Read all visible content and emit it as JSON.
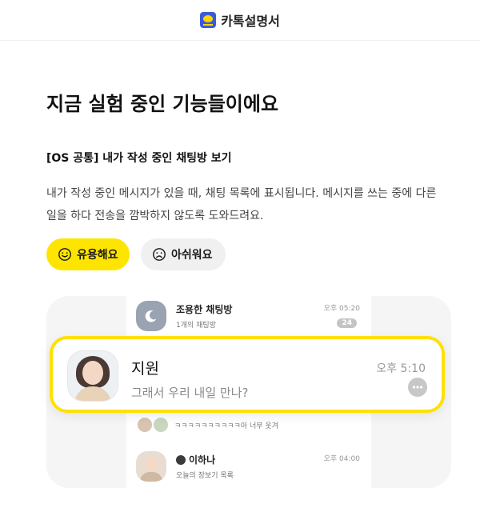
{
  "header": {
    "logo_text": "카톡설명서"
  },
  "page": {
    "title": "지금 실험 중인 기능들이에요",
    "feature_title": "[OS 공통] 내가 작성 중인 채팅방 보기",
    "description": "내가 작성 중인 메시지가 있을 때, 채팅 목록에 표시됩니다. 메시지를 쓰는 중에 다른 일을 하다 전송을 깜박하지 않도록 도와드려요."
  },
  "feedback": {
    "useful_label": "유용해요",
    "sorry_label": "아쉬워요"
  },
  "preview": {
    "rows": [
      {
        "name": "조용한 채팅방",
        "sub": "1개의 채팅방",
        "time": "오후 05:20",
        "badge": "24"
      },
      {
        "sub": "ㅋㅋㅋㅋㅋㅋㅋㅋㅋㅋ아 너무 웃겨"
      },
      {
        "name": "이하나",
        "sub": "오늘의 장보기 목록",
        "time": "오후 04:00"
      }
    ],
    "highlight": {
      "name": "지원",
      "message": "그래서 우리 내일 만나?",
      "time": "오후 5:10"
    }
  },
  "colors": {
    "accent_yellow": "#fee500",
    "highlight_border": "#ffe100"
  }
}
